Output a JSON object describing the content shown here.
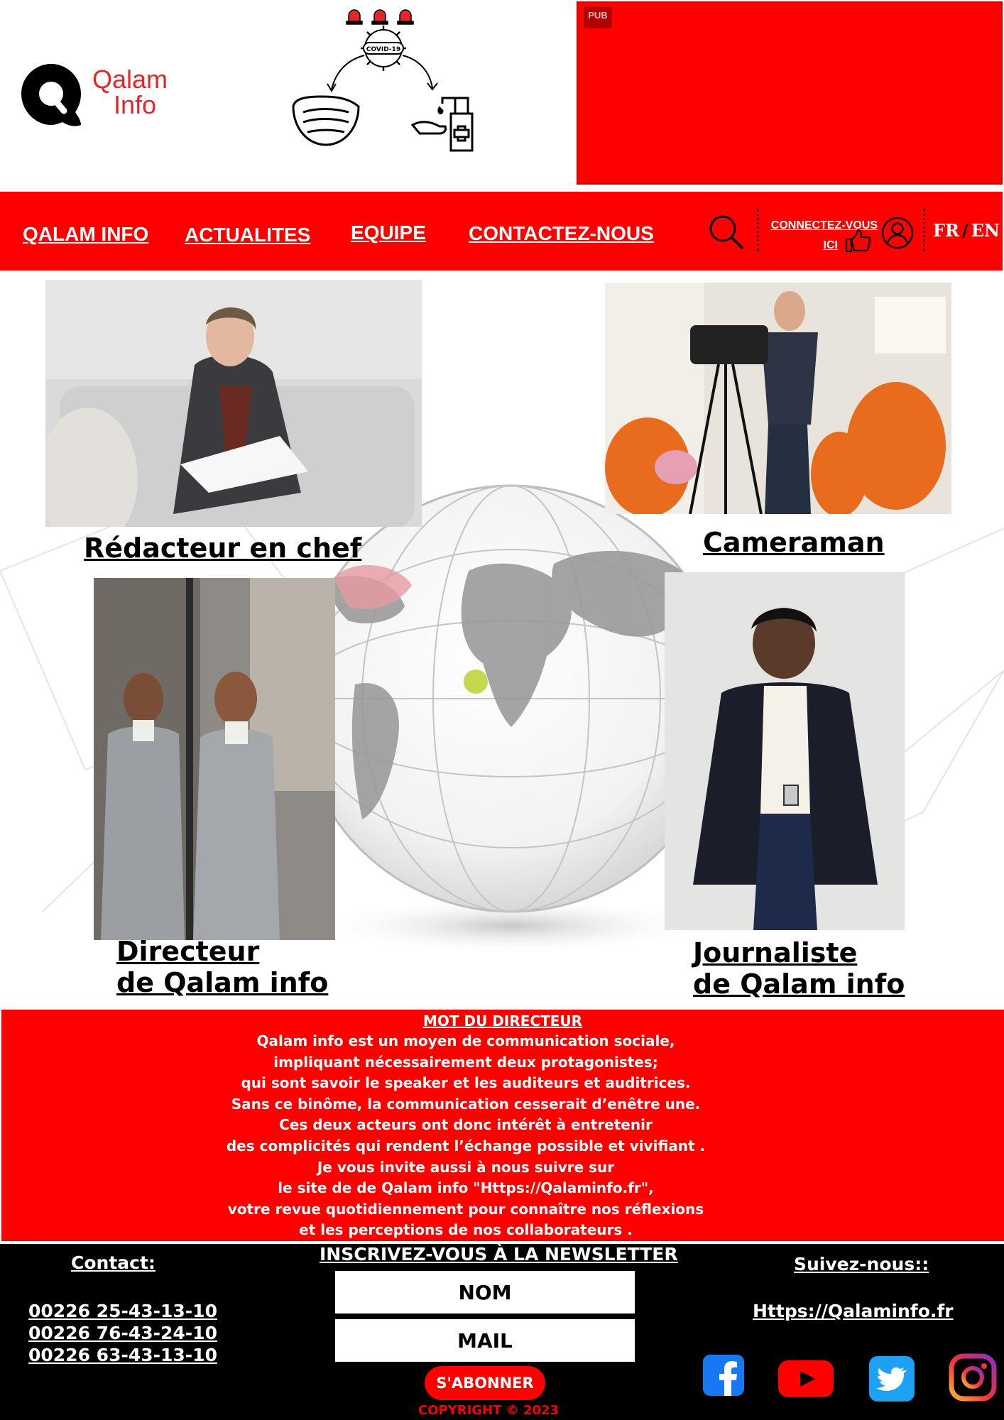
{
  "header": {
    "logo_line1": "Qalam",
    "logo_line2": "Info",
    "covid_label": "COVID-19",
    "ad_badge": "PUB"
  },
  "nav": {
    "items": [
      {
        "label": "QALAM INFO"
      },
      {
        "label": "ACTUALITES"
      },
      {
        "label": "EQUIPE"
      },
      {
        "label": "CONTACTEZ-NOUS"
      }
    ],
    "connect_line1": "CONNECTEZ-VOUS",
    "connect_line2": "ICI",
    "lang_fr": "FR",
    "lang_sep": "/",
    "lang_en": "EN"
  },
  "team": [
    {
      "line1": "Rédacteur en chef"
    },
    {
      "line1": "Cameraman"
    },
    {
      "line1": "Directeur ",
      "line2": "de Qalam info"
    },
    {
      "line1": "Journaliste",
      "line2": " de Qalam info"
    }
  ],
  "director": {
    "title": "MOT DU DIRECTEUR ",
    "lines": [
      "Qalam info est un moyen de communication sociale,",
      "impliquant nécessairement deux protagonistes;",
      "qui sont savoir le speaker et les auditeurs et auditrices.",
      "Sans ce binôme, la communication cesserait d’enêtre une.",
      "Ces deux acteurs ont donc intérêt à entretenir",
      "des complicités qui rendent l’échange possible et vivifiant .",
      "Je vous invite aussi à nous suivre  sur",
      "le site de de Qalam info \"Https://Qalaminfo.fr\",",
      "votre revue quotidiennement pour connaître nos réflexions",
      "et les perceptions de nos collaborateurs ."
    ]
  },
  "footer": {
    "contact_title": "Contact:",
    "phones": [
      "00226 25-43-13-10",
      "00226 76-43-24-10",
      "00226 63-43-13-10"
    ],
    "newsletter_title": "INSCRIVEZ-VOUS À LA NEWSLETTER",
    "name_placeholder": "NOM",
    "mail_placeholder": "MAIL",
    "subscribe_label": "S'ABONNER",
    "copyright": "COPYRIGHT © 2023",
    "follow_title": "Suivez-nous::",
    "site_link": "Https://Qalaminfo.fr",
    "social_icons": [
      "facebook-icon",
      "youtube-icon",
      "twitter-icon",
      "instagram-icon"
    ]
  },
  "colors": {
    "brand_red": "#ff0000",
    "logo_red": "#e3262b",
    "footer_bg": "#000000",
    "facebook": "#1877f2",
    "youtube": "#ff0000",
    "twitter": "#1da1f2"
  }
}
